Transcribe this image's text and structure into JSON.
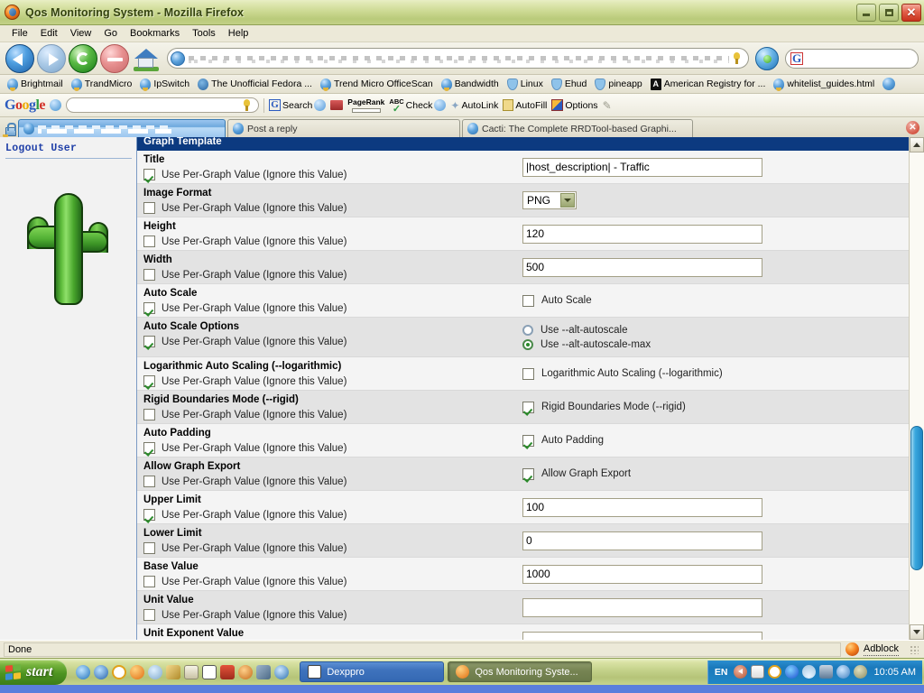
{
  "window": {
    "title": "Qos Monitoring System - Mozilla Firefox",
    "minimize_label": "",
    "maximize_label": "",
    "close_label": "✕"
  },
  "menubar": [
    {
      "label": "File"
    },
    {
      "label": "Edit"
    },
    {
      "label": "View"
    },
    {
      "label": "Go"
    },
    {
      "label": "Bookmarks"
    },
    {
      "label": "Tools"
    },
    {
      "label": "Help"
    }
  ],
  "navbar": {
    "back": "Back",
    "forward": "Forward",
    "reload": "Reload",
    "stop": "Stop",
    "home": "Home",
    "url_value": "",
    "search_value": ""
  },
  "bookmarks": [
    {
      "label": "Brightmail",
      "icon": "globe-icon"
    },
    {
      "label": "TrandMicro",
      "icon": "globe-icon"
    },
    {
      "label": "IpSwitch",
      "icon": "globe-icon"
    },
    {
      "label": "The Unofficial Fedora ...",
      "icon": "fedora-icon"
    },
    {
      "label": "Trend Micro OfficeScan",
      "icon": "globe-icon"
    },
    {
      "label": "Bandwidth",
      "icon": "globe-icon"
    },
    {
      "label": "Linux",
      "icon": "shield-icon"
    },
    {
      "label": "Ehud",
      "icon": "shield-icon"
    },
    {
      "label": "pineapp",
      "icon": "shield-icon"
    },
    {
      "label": "American Registry for ...",
      "icon": "amreg-icon"
    },
    {
      "label": "whitelist_guides.html",
      "icon": "globe-icon"
    }
  ],
  "google_toolbar": {
    "logo": "Google",
    "search_value": "",
    "items": [
      {
        "label": "Search",
        "icon": "google-g-icon"
      },
      {
        "label": "",
        "icon": "bookmarks-book-icon"
      },
      {
        "label": "PageRank",
        "icon": "pagerank-icon"
      },
      {
        "label": "Check",
        "icon": "spellcheck-abc-icon"
      },
      {
        "label": "AutoLink",
        "icon": "autolink-star-icon"
      },
      {
        "label": "AutoFill",
        "icon": "autofill-form-icon"
      },
      {
        "label": "Options",
        "icon": "options-icon"
      }
    ]
  },
  "tabs": [
    {
      "label": "",
      "active": true,
      "redacted": true
    },
    {
      "label": "Post a reply",
      "active": false,
      "redacted": false
    },
    {
      "label": "Cacti: The Complete RRDTool-based Graphi...",
      "active": false,
      "redacted": false
    }
  ],
  "tabbar": {
    "close_label": "✕"
  },
  "sidebar": {
    "logout_label": "Logout User",
    "logo_name": "cacti-cactus-logo"
  },
  "page": {
    "section_title": "Graph Template",
    "per_graph_label": "Use Per-Graph Value (Ignore this Value)",
    "fields": [
      {
        "label": "Title",
        "per_graph_checked": true,
        "control": "text",
        "value": "|host_description| - Traffic"
      },
      {
        "label": "Image Format",
        "per_graph_checked": false,
        "control": "select",
        "value": "PNG"
      },
      {
        "label": "Height",
        "per_graph_checked": false,
        "control": "text",
        "value": "120"
      },
      {
        "label": "Width",
        "per_graph_checked": false,
        "control": "text",
        "value": "500"
      },
      {
        "label": "Auto Scale",
        "per_graph_checked": true,
        "control": "checkbox",
        "checkbox_label": "Auto Scale",
        "checkbox_checked": false
      },
      {
        "label": "Auto Scale Options",
        "per_graph_checked": true,
        "control": "radio",
        "options": [
          {
            "label": "Use --alt-autoscale",
            "selected": false
          },
          {
            "label": "Use --alt-autoscale-max",
            "selected": true
          }
        ]
      },
      {
        "label": "Logarithmic Auto Scaling (--logarithmic)",
        "per_graph_checked": true,
        "control": "checkbox",
        "checkbox_label": "Logarithmic Auto Scaling (--logarithmic)",
        "checkbox_checked": false
      },
      {
        "label": "Rigid Boundaries Mode (--rigid)",
        "per_graph_checked": false,
        "control": "checkbox",
        "checkbox_label": "Rigid Boundaries Mode (--rigid)",
        "checkbox_checked": true
      },
      {
        "label": "Auto Padding",
        "per_graph_checked": true,
        "control": "checkbox",
        "checkbox_label": "Auto Padding",
        "checkbox_checked": true
      },
      {
        "label": "Allow Graph Export",
        "per_graph_checked": false,
        "control": "checkbox",
        "checkbox_label": "Allow Graph Export",
        "checkbox_checked": true
      },
      {
        "label": "Upper Limit",
        "per_graph_checked": true,
        "control": "text",
        "value": "100"
      },
      {
        "label": "Lower Limit",
        "per_graph_checked": false,
        "control": "text",
        "value": "0"
      },
      {
        "label": "Base Value",
        "per_graph_checked": false,
        "control": "text",
        "value": "1000"
      },
      {
        "label": "Unit Value",
        "per_graph_checked": false,
        "control": "text",
        "value": ""
      },
      {
        "label": "Unit Exponent Value",
        "per_graph_checked": false,
        "control": "text",
        "value": ""
      }
    ]
  },
  "statusbar": {
    "message": "Done",
    "adblock_label": "Adblock"
  },
  "taskbar": {
    "start_label": "start",
    "tasks": [
      {
        "label": "Dexppro",
        "active": false,
        "icon": "cow-icon"
      },
      {
        "label": "Qos Monitoring Syste...",
        "active": true,
        "icon": "firefox-icon"
      }
    ],
    "tray_locale": "EN",
    "time": "10:05 AM"
  },
  "colors": {
    "header_blue": "#0c3a80",
    "xp_green": "#c3d189",
    "link_blue": "#1f3fa8",
    "row_odd": "#e3e3e3",
    "row_even": "#f4f4f4"
  }
}
